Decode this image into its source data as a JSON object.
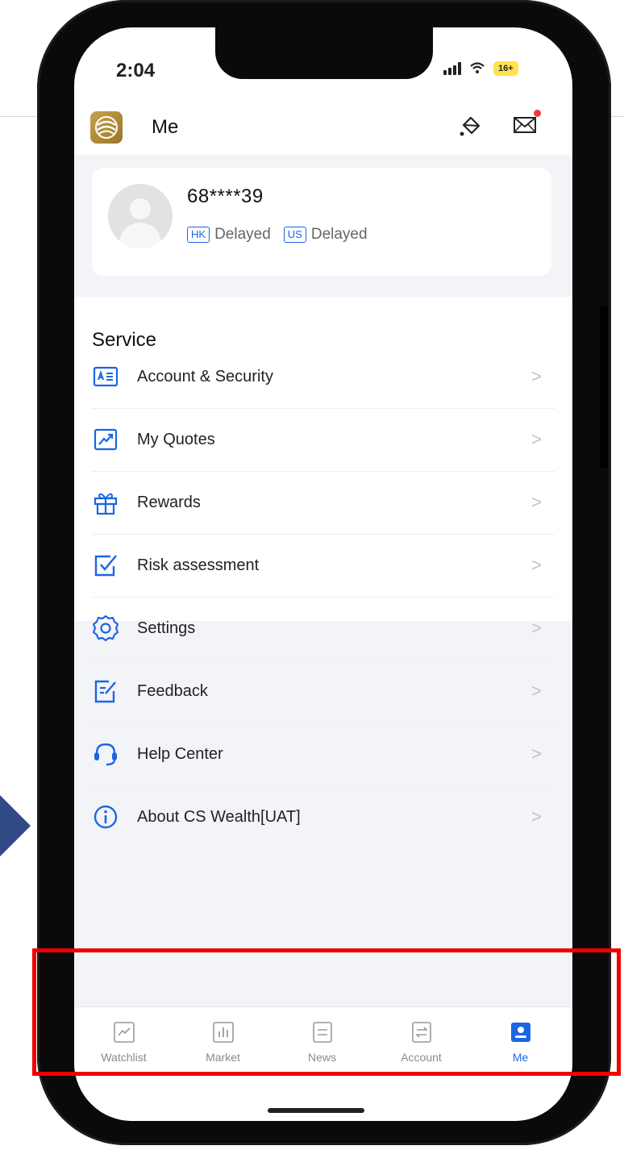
{
  "status_bar": {
    "time": "2:04",
    "battery": "16+"
  },
  "header": {
    "title": "Me"
  },
  "profile": {
    "account_id": "68****39",
    "markets": [
      {
        "code": "HK",
        "status": "Delayed"
      },
      {
        "code": "US",
        "status": "Delayed"
      }
    ]
  },
  "service": {
    "heading": "Service",
    "items": [
      {
        "label": "Account & Security",
        "icon": "id-card-icon"
      },
      {
        "label": "My Quotes",
        "icon": "trend-chart-icon"
      },
      {
        "label": "Rewards",
        "icon": "gift-icon"
      },
      {
        "label": "Risk assessment",
        "icon": "checkbox-icon"
      },
      {
        "label": "Settings",
        "icon": "gear-icon"
      },
      {
        "label": "Feedback",
        "icon": "feedback-edit-icon"
      },
      {
        "label": "Help Center",
        "icon": "headset-icon"
      },
      {
        "label": "About CS Wealth[UAT]",
        "icon": "info-icon"
      }
    ],
    "chevron": ">"
  },
  "tabbar": {
    "tabs": [
      {
        "label": "Watchlist",
        "icon": "watchlist-icon",
        "active": false
      },
      {
        "label": "Market",
        "icon": "market-bars-icon",
        "active": false
      },
      {
        "label": "News",
        "icon": "news-icon",
        "active": false
      },
      {
        "label": "Account",
        "icon": "account-transfer-icon",
        "active": false
      },
      {
        "label": "Me",
        "icon": "person-icon",
        "active": true
      }
    ]
  },
  "colors": {
    "accent": "#1a66e6",
    "highlight": "#f00000",
    "badge_dot": "#f03a3a",
    "logo": "#b08d3b",
    "background_gray": "#f3f4f7"
  }
}
